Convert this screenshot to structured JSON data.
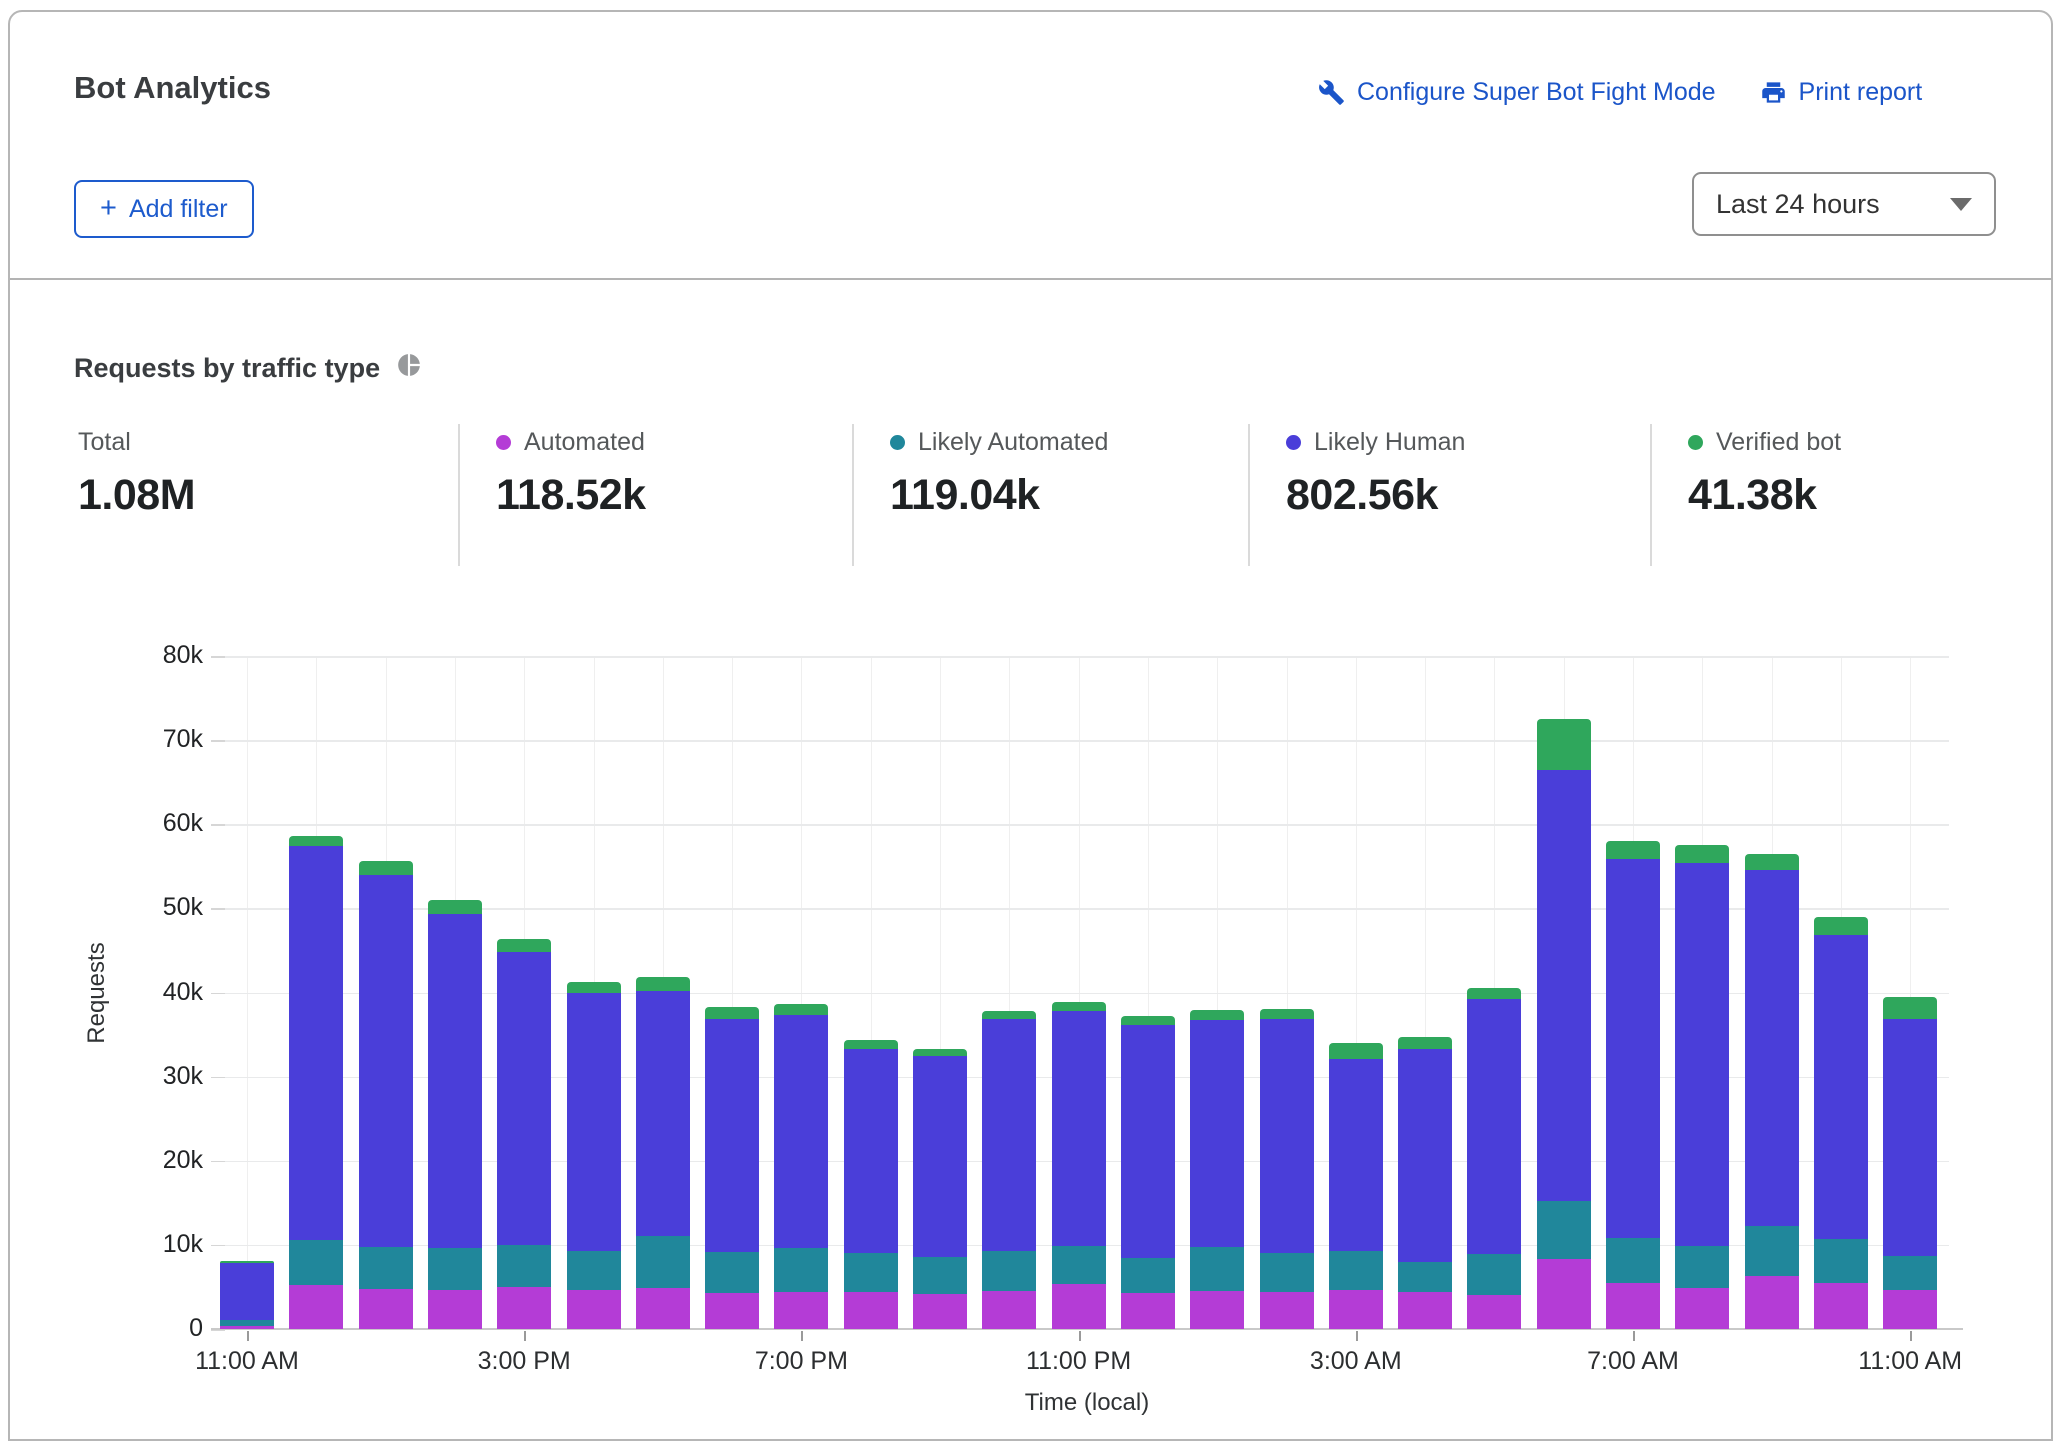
{
  "header": {
    "title": "Bot Analytics",
    "links": {
      "configure": "Configure Super Bot Fight Mode",
      "print": "Print report"
    },
    "add_filter": {
      "plus": "+",
      "label": "Add filter"
    },
    "time_range": {
      "value": "Last 24 hours"
    }
  },
  "section": {
    "title": "Requests by traffic type"
  },
  "stats": [
    {
      "label": "Total",
      "value": "1.08M",
      "color": ""
    },
    {
      "label": "Automated",
      "value": "118.52k",
      "color": "#b43cd6"
    },
    {
      "label": "Likely Automated",
      "value": "119.04k",
      "color": "#20879b"
    },
    {
      "label": "Likely Human",
      "value": "802.56k",
      "color": "#4a3ed9"
    },
    {
      "label": "Verified bot",
      "value": "41.38k",
      "color": "#2fa75c"
    }
  ],
  "chart_data": {
    "type": "bar",
    "stacked": true,
    "title": "Requests by traffic type",
    "xlabel": "Time (local)",
    "ylabel": "Requests",
    "ylim": [
      0,
      80000
    ],
    "ytick_step": 10000,
    "ytick_labels": [
      "0",
      "10k",
      "20k",
      "30k",
      "40k",
      "50k",
      "60k",
      "70k",
      "80k"
    ],
    "grid": true,
    "legend_position": "top",
    "x": [
      "11:00 AM",
      "12:00 PM",
      "1:00 PM",
      "2:00 PM",
      "3:00 PM",
      "4:00 PM",
      "5:00 PM",
      "6:00 PM",
      "7:00 PM",
      "8:00 PM",
      "9:00 PM",
      "10:00 PM",
      "11:00 PM",
      "12:00 AM",
      "1:00 AM",
      "2:00 AM",
      "3:00 AM",
      "4:00 AM",
      "5:00 AM",
      "6:00 AM",
      "7:00 AM",
      "8:00 AM",
      "9:00 AM",
      "10:00 AM",
      "11:00 AM"
    ],
    "xtick_label_every": 4,
    "series": [
      {
        "name": "Automated",
        "color": "#b43cd6",
        "values": [
          400,
          5200,
          4700,
          4600,
          5000,
          4600,
          4900,
          4300,
          4400,
          4400,
          4200,
          4500,
          5300,
          4300,
          4500,
          4400,
          4600,
          4400,
          4000,
          8300,
          5500,
          4900,
          6300,
          5500,
          4600
        ]
      },
      {
        "name": "Likely Automated",
        "color": "#20879b",
        "values": [
          700,
          5400,
          5100,
          5000,
          5000,
          4700,
          6100,
          4800,
          5200,
          4600,
          4400,
          4800,
          4600,
          4200,
          5200,
          4600,
          4700,
          3600,
          4900,
          6900,
          5300,
          5000,
          5900,
          5200,
          4100
        ]
      },
      {
        "name": "Likely Human",
        "color": "#4a3ed9",
        "values": [
          6700,
          46800,
          44200,
          39700,
          34800,
          30600,
          29200,
          27800,
          27700,
          24300,
          23800,
          27500,
          27900,
          27600,
          27000,
          27800,
          22800,
          25300,
          30300,
          51300,
          45100,
          45500,
          42400,
          36100,
          28200
        ]
      },
      {
        "name": "Verified bot",
        "color": "#2fa75c",
        "values": [
          300,
          1200,
          1600,
          1700,
          1600,
          1400,
          1600,
          1400,
          1300,
          1000,
          900,
          1000,
          1100,
          1100,
          1200,
          1200,
          1900,
          1400,
          1300,
          6000,
          2100,
          2100,
          1900,
          2200,
          2600
        ]
      }
    ]
  }
}
